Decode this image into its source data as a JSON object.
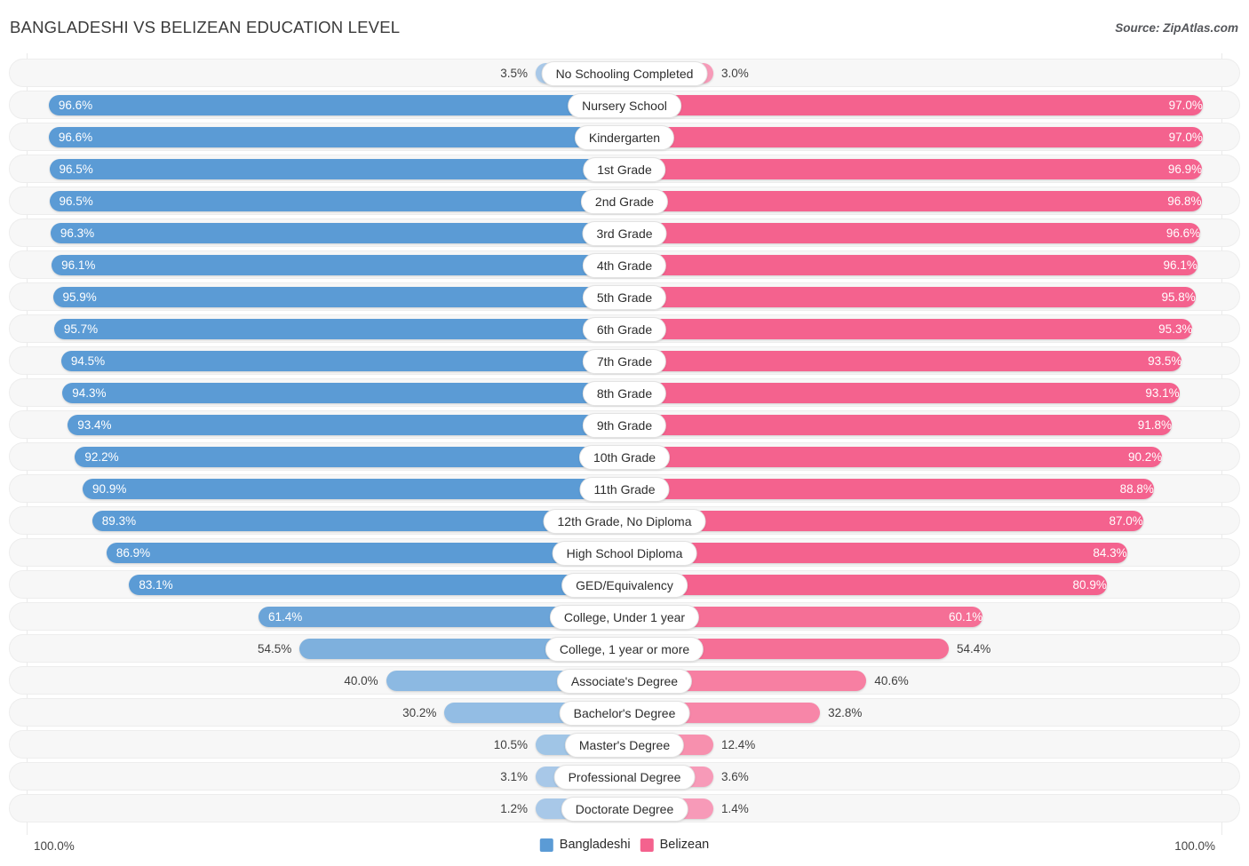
{
  "header": {
    "title": "BANGLADESHI VS BELIZEAN EDUCATION LEVEL",
    "source": "Source: ZipAtlas.com"
  },
  "legend": {
    "left": {
      "label": "Bangladeshi",
      "color": "#5b9bd5"
    },
    "right": {
      "label": "Belizean",
      "color": "#f4628e"
    }
  },
  "axis": {
    "left_max": "100.0%",
    "right_max": "100.0%"
  },
  "chart_data": {
    "type": "bar",
    "title": "BANGLADESHI VS BELIZEAN EDUCATION LEVEL",
    "xlabel": "",
    "ylabel": "",
    "xlim": [
      0,
      100
    ],
    "grid": true,
    "legend_position": "bottom-center",
    "orientation": "horizontal-diverging",
    "categories": [
      "No Schooling Completed",
      "Nursery School",
      "Kindergarten",
      "1st Grade",
      "2nd Grade",
      "3rd Grade",
      "4th Grade",
      "5th Grade",
      "6th Grade",
      "7th Grade",
      "8th Grade",
      "9th Grade",
      "10th Grade",
      "11th Grade",
      "12th Grade, No Diploma",
      "High School Diploma",
      "GED/Equivalency",
      "College, Under 1 year",
      "College, 1 year or more",
      "Associate's Degree",
      "Bachelor's Degree",
      "Master's Degree",
      "Professional Degree",
      "Doctorate Degree"
    ],
    "series": [
      {
        "name": "Bangladeshi",
        "color": "#5b9bd5",
        "values": [
          3.5,
          96.6,
          96.6,
          96.5,
          96.5,
          96.3,
          96.1,
          95.9,
          95.7,
          94.5,
          94.3,
          93.4,
          92.2,
          90.9,
          89.3,
          86.9,
          83.1,
          61.4,
          54.5,
          40.0,
          30.2,
          10.5,
          3.1,
          1.2
        ]
      },
      {
        "name": "Belizean",
        "color": "#f4628e",
        "values": [
          3.0,
          97.0,
          97.0,
          96.9,
          96.8,
          96.6,
          96.1,
          95.8,
          95.3,
          93.5,
          93.1,
          91.8,
          90.2,
          88.8,
          87.0,
          84.3,
          80.9,
          60.1,
          54.4,
          40.6,
          32.8,
          12.4,
          3.6,
          1.4
        ]
      }
    ]
  },
  "rows": [
    {
      "label": "No Schooling Completed",
      "left": "3.5%",
      "right": "3.0%",
      "left_val": 3.5,
      "right_val": 3.0,
      "left_inside": false,
      "right_inside": false,
      "left_color": "#a8c8e8",
      "right_color": "#f79ab8"
    },
    {
      "label": "Nursery School",
      "left": "96.6%",
      "right": "97.0%",
      "left_val": 96.6,
      "right_val": 97.0,
      "left_inside": true,
      "right_inside": true,
      "left_color": "#5b9bd5",
      "right_color": "#f4628e"
    },
    {
      "label": "Kindergarten",
      "left": "96.6%",
      "right": "97.0%",
      "left_val": 96.6,
      "right_val": 97.0,
      "left_inside": true,
      "right_inside": true,
      "left_color": "#5b9bd5",
      "right_color": "#f4628e"
    },
    {
      "label": "1st Grade",
      "left": "96.5%",
      "right": "96.9%",
      "left_val": 96.5,
      "right_val": 96.9,
      "left_inside": true,
      "right_inside": true,
      "left_color": "#5b9bd5",
      "right_color": "#f4628e"
    },
    {
      "label": "2nd Grade",
      "left": "96.5%",
      "right": "96.8%",
      "left_val": 96.5,
      "right_val": 96.8,
      "left_inside": true,
      "right_inside": true,
      "left_color": "#5b9bd5",
      "right_color": "#f4628e"
    },
    {
      "label": "3rd Grade",
      "left": "96.3%",
      "right": "96.6%",
      "left_val": 96.3,
      "right_val": 96.6,
      "left_inside": true,
      "right_inside": true,
      "left_color": "#5b9bd5",
      "right_color": "#f4628e"
    },
    {
      "label": "4th Grade",
      "left": "96.1%",
      "right": "96.1%",
      "left_val": 96.1,
      "right_val": 96.1,
      "left_inside": true,
      "right_inside": true,
      "left_color": "#5b9bd5",
      "right_color": "#f4628e"
    },
    {
      "label": "5th Grade",
      "left": "95.9%",
      "right": "95.8%",
      "left_val": 95.9,
      "right_val": 95.8,
      "left_inside": true,
      "right_inside": true,
      "left_color": "#5b9bd5",
      "right_color": "#f4628e"
    },
    {
      "label": "6th Grade",
      "left": "95.7%",
      "right": "95.3%",
      "left_val": 95.7,
      "right_val": 95.3,
      "left_inside": true,
      "right_inside": true,
      "left_color": "#5b9bd5",
      "right_color": "#f4628e"
    },
    {
      "label": "7th Grade",
      "left": "94.5%",
      "right": "93.5%",
      "left_val": 94.5,
      "right_val": 93.5,
      "left_inside": true,
      "right_inside": true,
      "left_color": "#5b9bd5",
      "right_color": "#f4628e"
    },
    {
      "label": "8th Grade",
      "left": "94.3%",
      "right": "93.1%",
      "left_val": 94.3,
      "right_val": 93.1,
      "left_inside": true,
      "right_inside": true,
      "left_color": "#5b9bd5",
      "right_color": "#f4628e"
    },
    {
      "label": "9th Grade",
      "left": "93.4%",
      "right": "91.8%",
      "left_val": 93.4,
      "right_val": 91.8,
      "left_inside": true,
      "right_inside": true,
      "left_color": "#5b9bd5",
      "right_color": "#f4628e"
    },
    {
      "label": "10th Grade",
      "left": "92.2%",
      "right": "90.2%",
      "left_val": 92.2,
      "right_val": 90.2,
      "left_inside": true,
      "right_inside": true,
      "left_color": "#5b9bd5",
      "right_color": "#f4628e"
    },
    {
      "label": "11th Grade",
      "left": "90.9%",
      "right": "88.8%",
      "left_val": 90.9,
      "right_val": 88.8,
      "left_inside": true,
      "right_inside": true,
      "left_color": "#5b9bd5",
      "right_color": "#f4628e"
    },
    {
      "label": "12th Grade, No Diploma",
      "left": "89.3%",
      "right": "87.0%",
      "left_val": 89.3,
      "right_val": 87.0,
      "left_inside": true,
      "right_inside": true,
      "left_color": "#5b9bd5",
      "right_color": "#f4628e"
    },
    {
      "label": "High School Diploma",
      "left": "86.9%",
      "right": "84.3%",
      "left_val": 86.9,
      "right_val": 84.3,
      "left_inside": true,
      "right_inside": true,
      "left_color": "#5b9bd5",
      "right_color": "#f4628e"
    },
    {
      "label": "GED/Equivalency",
      "left": "83.1%",
      "right": "80.9%",
      "left_val": 83.1,
      "right_val": 80.9,
      "left_inside": true,
      "right_inside": true,
      "left_color": "#5b9bd5",
      "right_color": "#f4628e"
    },
    {
      "label": "College, Under 1 year",
      "left": "61.4%",
      "right": "60.1%",
      "left_val": 61.4,
      "right_val": 60.1,
      "left_inside": true,
      "right_inside": true,
      "left_color": "#6ba4d8",
      "right_color": "#f56f96"
    },
    {
      "label": "College, 1 year or more",
      "left": "54.5%",
      "right": "54.4%",
      "left_val": 54.5,
      "right_val": 54.4,
      "left_inside": false,
      "right_inside": false,
      "left_color": "#7eb0dd",
      "right_color": "#f56f96"
    },
    {
      "label": "Associate's Degree",
      "left": "40.0%",
      "right": "40.6%",
      "left_val": 40.0,
      "right_val": 40.6,
      "left_inside": false,
      "right_inside": false,
      "left_color": "#8cb9e2",
      "right_color": "#f77fa2"
    },
    {
      "label": "Bachelor's Degree",
      "left": "30.2%",
      "right": "32.8%",
      "left_val": 30.2,
      "right_val": 32.8,
      "left_inside": false,
      "right_inside": false,
      "left_color": "#93bde4",
      "right_color": "#f786a8"
    },
    {
      "label": "Master's Degree",
      "left": "10.5%",
      "right": "12.4%",
      "left_val": 10.5,
      "right_val": 12.4,
      "left_inside": false,
      "right_inside": false,
      "left_color": "#a0c5e6",
      "right_color": "#f790ae"
    },
    {
      "label": "Professional Degree",
      "left": "3.1%",
      "right": "3.6%",
      "left_val": 3.1,
      "right_val": 3.6,
      "left_inside": false,
      "right_inside": false,
      "left_color": "#a8c8e8",
      "right_color": "#f79ab8"
    },
    {
      "label": "Doctorate Degree",
      "left": "1.2%",
      "right": "1.4%",
      "left_val": 1.2,
      "right_val": 1.4,
      "left_inside": false,
      "right_inside": false,
      "left_color": "#a8c8e8",
      "right_color": "#f79ab8"
    }
  ]
}
